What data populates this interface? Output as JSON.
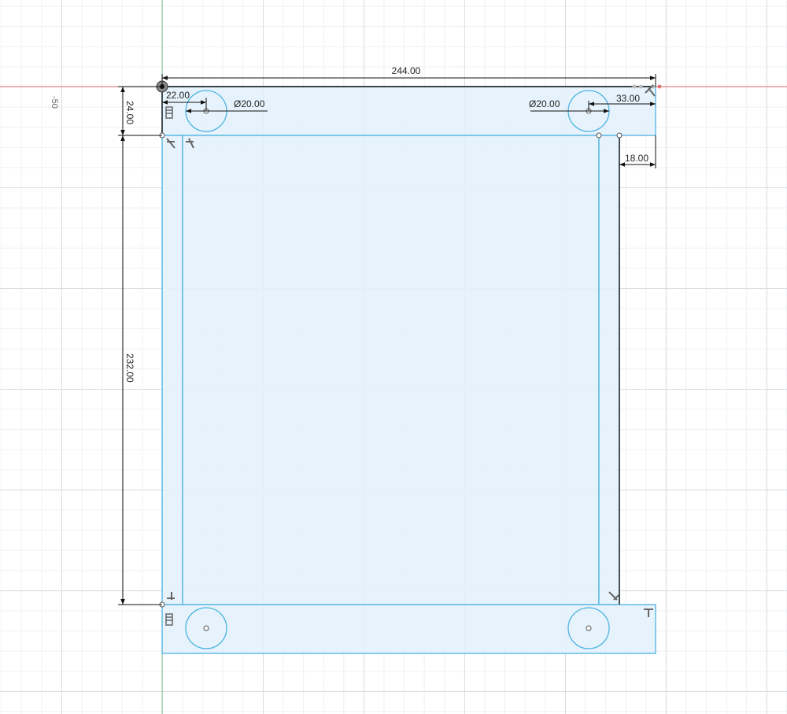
{
  "app": {
    "view": "sketch-canvas"
  },
  "axis_labels": {
    "y_offset": "-50"
  },
  "dimensions": {
    "overall_width": "244.00",
    "top_height": "24.00",
    "side_length": "232.00",
    "left_hole_offset": "22.00",
    "right_hole_offset": "33.00",
    "right_inset": "18.00",
    "left_hole_diameter": "Ø20.00",
    "right_hole_diameter": "Ø20.00"
  },
  "colors": {
    "sketch_fill": "#e3f1fb",
    "sketch_stroke": "#4db3e0",
    "dimension_line": "#111111",
    "x_axis": "#e57373",
    "y_axis": "#7fcf86",
    "grid_major": "#d9dde2",
    "grid_minor": "#eef0f3"
  },
  "icons": [
    "perpendicular-icon",
    "fix-constraint-icon",
    "coincident-point-icon",
    "origin-icon"
  ]
}
